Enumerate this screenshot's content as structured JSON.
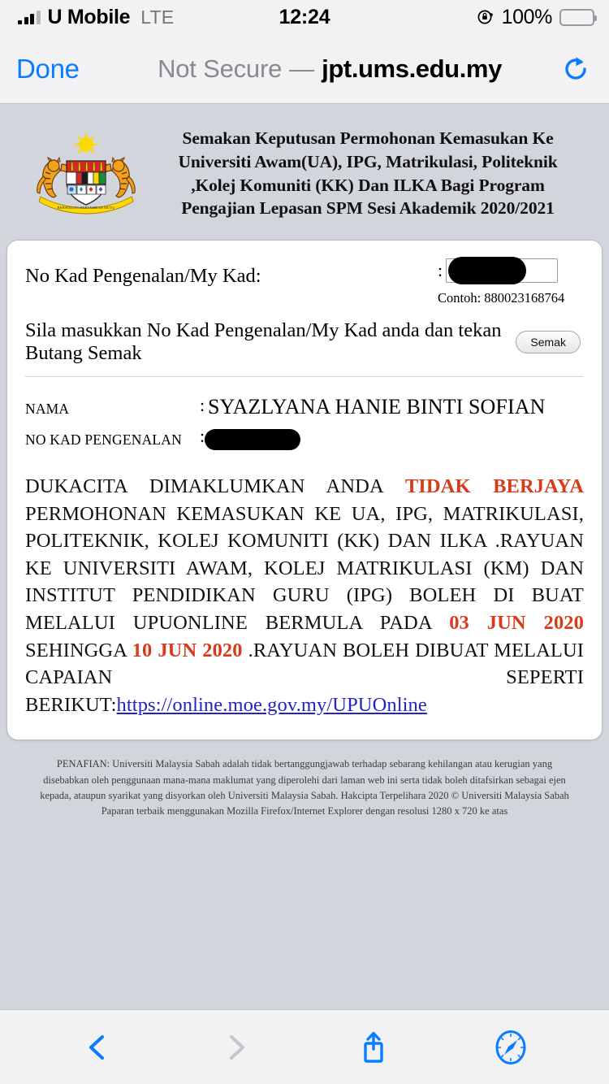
{
  "status_bar": {
    "carrier": "U Mobile",
    "network": "LTE",
    "time": "12:24",
    "battery_percent": "100%",
    "signal_bars_filled": 3,
    "signal_bars_total": 4,
    "rotation_lock_icon": "rotation-lock-icon",
    "battery_icon": "battery-full-icon"
  },
  "browser_bar": {
    "done_label": "Done",
    "security_label": "Not Secure",
    "separator": "—",
    "host": "jpt.ums.edu.my",
    "reload_icon": "reload-icon"
  },
  "site": {
    "crest_icon": "malaysia-coat-of-arms-icon",
    "title": "Semakan Keputusan Permohonan Kemasukan Ke Universiti Awam(UA), IPG, Matrikulasi, Politeknik ,Kolej Komuniti (KK) Dan ILKA Bagi Program Pengajian Lepasan SPM Sesi Akademik 2020/2021"
  },
  "form": {
    "ic_label": "No Kad Pengenalan/My Kad:",
    "ic_colon": ":",
    "ic_value": "",
    "ic_placeholder": "",
    "example_hint": "Contoh: 880023168764",
    "instruction": "Sila masukkan No Kad Pengenalan/My Kad anda dan tekan Butang Semak",
    "submit_label": "Semak"
  },
  "applicant": {
    "rows": [
      {
        "key": "NAMA",
        "sep": ":",
        "value": "SYAZLYANA HANIE BINTI SOFIAN",
        "redacted": false
      },
      {
        "key": "NO KAD PENGENALAN",
        "sep": ":",
        "value": "",
        "redacted": true
      }
    ]
  },
  "result": {
    "part1": "DUKACITA DIMAKLUMKAN ANDA ",
    "highlight1": "TIDAK",
    "gap1": "  ",
    "highlight2": "BERJAYA",
    "part2": " PERMOHONAN KEMASUKAN  KE UA, IPG, MATRIKULASI, POLITEKNIK, KOLEJ KOMUNITI (KK) DAN ILKA .RAYUAN KE UNIVERSITI AWAM, KOLEJ MATRIKULASI (KM) DAN INSTITUT PENDIDIKAN GURU (IPG) BOLEH DI BUAT MELALUI UPUONLINE BERMULA PADA ",
    "date_start": "03 JUN 2020",
    "part3": " SEHINGGA ",
    "date_end": "10 JUN 2020",
    "part4": " .RAYUAN BOLEH DIBUAT MELALUI CAPAIAN SEPERTI BERIKUT:",
    "link_text": "https://online.moe.gov.my/UPUOnline",
    "highlight_color": "#d93b1a",
    "link_color": "#2323c4"
  },
  "disclaimer": {
    "text": "PENAFIAN: Universiti Malaysia Sabah adalah tidak bertanggungjawab terhadap sebarang kehilangan atau kerugian yang disebabkan oleh penggunaan mana-mana maklumat yang diperolehi dari laman web ini serta tidak boleh ditafsirkan sebagai ejen kepada, ataupun syarikat yang disyorkan oleh Universiti Malaysia Sabah. Hakcipta Terpelihara 2020 © Universiti Malaysia Sabah Paparan terbaik menggunakan Mozilla Firefox/Internet Explorer dengan resolusi 1280 x 720 ke atas"
  },
  "toolbar": {
    "back_icon": "back-chevron-icon",
    "forward_icon": "forward-chevron-icon",
    "share_icon": "share-icon",
    "safari_icon": "safari-compass-icon",
    "back_enabled": true,
    "forward_enabled": false
  },
  "theme": {
    "page_background": "#d2d5dc",
    "chrome_background": "#f2f2f4",
    "accent_blue": "#0a7cff",
    "card_background": "#ffffff"
  }
}
